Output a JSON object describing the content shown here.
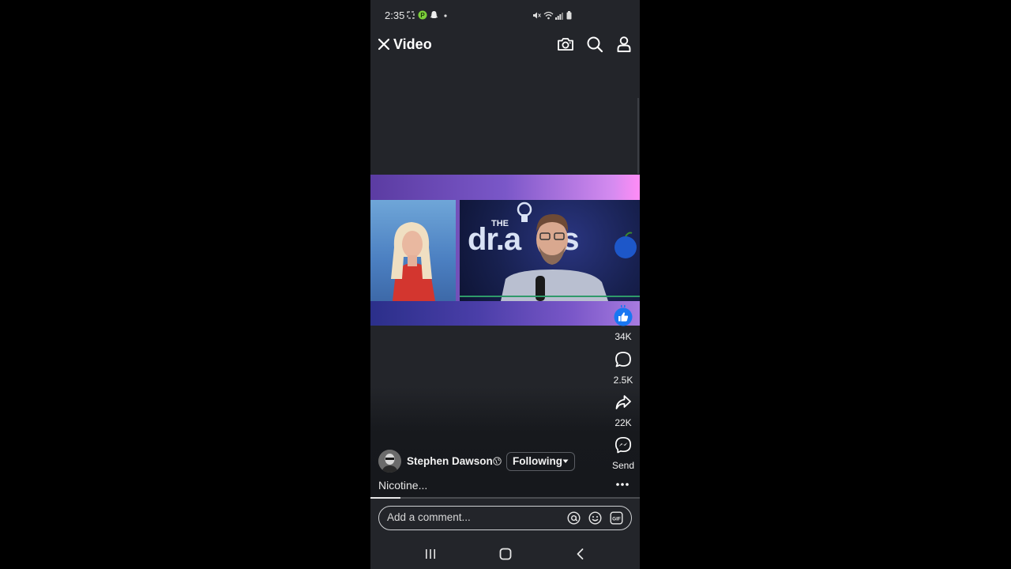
{
  "status_bar": {
    "time": "2:35",
    "left_icons": [
      "screenshot-icon",
      "app-notification-icon",
      "snapchat-icon",
      "dot-icon"
    ],
    "right_icons": [
      "mute-icon",
      "wifi-icon",
      "signal-icon",
      "battery-icon"
    ]
  },
  "header": {
    "title": "Video",
    "actions": [
      "camera-icon",
      "search-icon",
      "profile-icon"
    ]
  },
  "video": {
    "logo_the": "THE",
    "logo_text": "dr.a",
    "logo_text_tail": "is"
  },
  "actions": {
    "like_count": "34K",
    "comment_count": "2.5K",
    "share_count": "22K",
    "send_label": "Send"
  },
  "post": {
    "author": "Stephen Dawson",
    "following_label": "Following",
    "caption": "Nicotine...",
    "progress": 0.11
  },
  "comment": {
    "placeholder": "Add a comment..."
  },
  "colors": {
    "background": "#23252a",
    "like_blue": "#1877f2",
    "text": "#f2f2f2"
  }
}
